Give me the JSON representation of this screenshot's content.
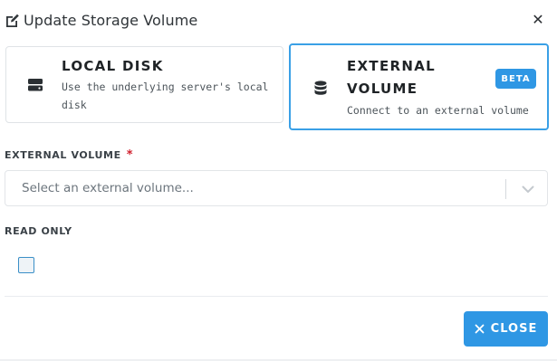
{
  "dialog": {
    "title": "Update Storage Volume",
    "title_icon": "edit-icon",
    "close_icon": "close-icon"
  },
  "storage_options": {
    "local": {
      "title": "LOCAL DISK",
      "description_line1": "Use the underlying server's local",
      "description_line2": "disk",
      "icon": "hard-drive-icon"
    },
    "external": {
      "title_line1": "EXTERNAL",
      "title_line2": "VOLUME",
      "description": "Connect to an external volume",
      "badge": "BETA",
      "icon": "database-icon",
      "selected": true
    }
  },
  "external_volume": {
    "label": "EXTERNAL VOLUME",
    "required_marker": "*",
    "placeholder": "Select an external volume..."
  },
  "read_only": {
    "label": "READ ONLY",
    "checked": false
  },
  "footer": {
    "close_label": "CLOSE"
  },
  "colors": {
    "accent": "#2f97e4",
    "selected_border": "#3aa0e6",
    "required": "#d0202e"
  }
}
